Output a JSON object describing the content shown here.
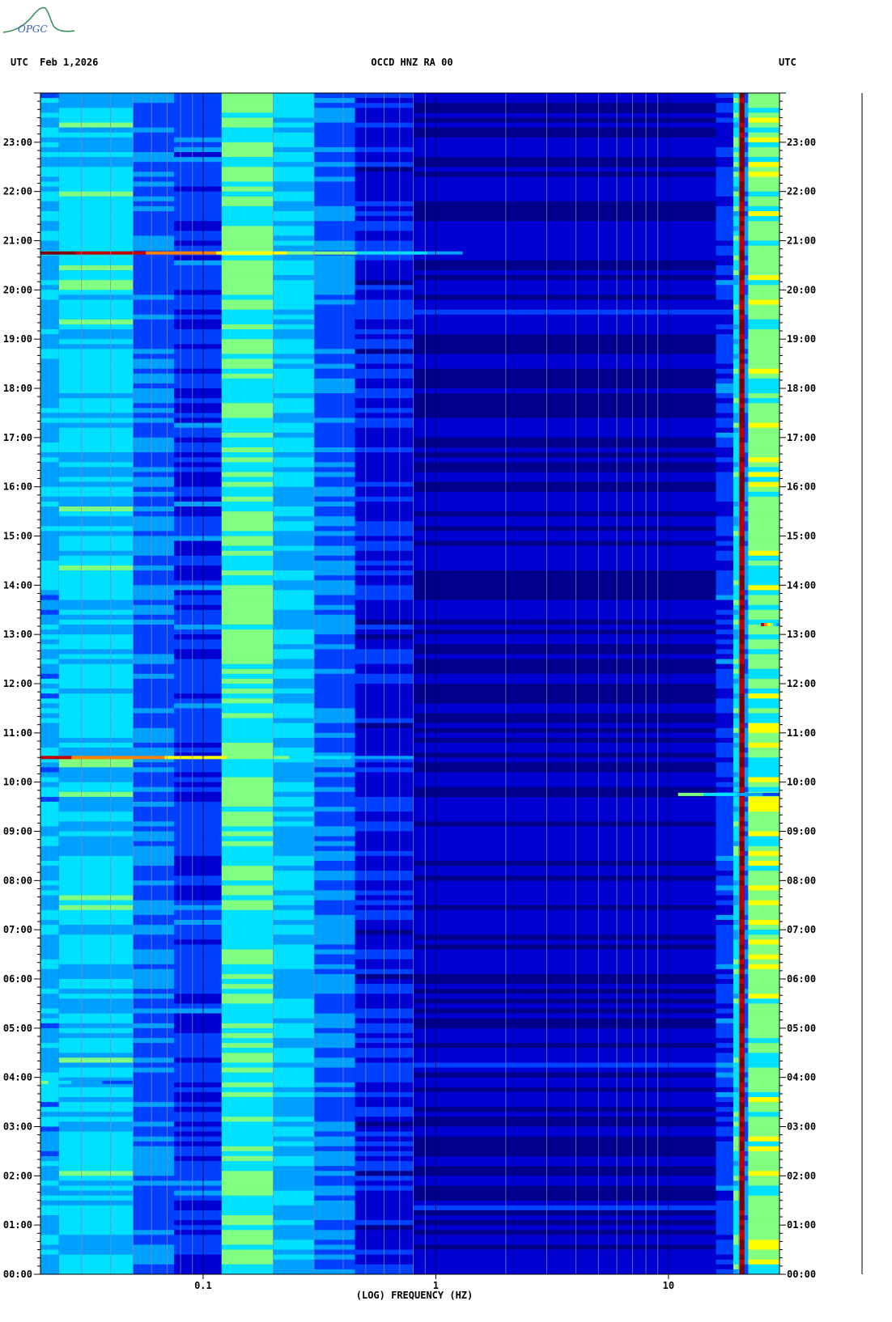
{
  "header": {
    "left": "UTC  Feb 1,2026",
    "center": "OCCD HNZ RA 00",
    "right": "UTC"
  },
  "logo": {
    "text": "OPGC",
    "color": "#2e8b57"
  },
  "chart_data": {
    "type": "heatmap",
    "xlabel": "(LOG) FREQUENCY (HZ)",
    "x_scale": "log",
    "xlim": [
      0.02,
      30
    ],
    "x_ticks": [
      {
        "value": 0.1,
        "label": "0.1"
      },
      {
        "value": 1,
        "label": "1"
      },
      {
        "value": 10,
        "label": "10"
      }
    ],
    "ylim_hours": [
      0,
      24
    ],
    "y_ticks": [
      "00:00",
      "01:00",
      "02:00",
      "03:00",
      "04:00",
      "05:00",
      "06:00",
      "07:00",
      "08:00",
      "09:00",
      "10:00",
      "11:00",
      "12:00",
      "13:00",
      "14:00",
      "15:00",
      "16:00",
      "17:00",
      "18:00",
      "19:00",
      "20:00",
      "21:00",
      "22:00",
      "23:00"
    ],
    "colorscale": [
      "#00008c",
      "#0000d2",
      "#0040ff",
      "#00a0ff",
      "#00e0ff",
      "#80ff80",
      "#ffff00",
      "#ff8000",
      "#c00000",
      "#800000"
    ],
    "bands": [
      {
        "from": 0.02,
        "to": 0.024,
        "level": 0.36
      },
      {
        "from": 0.024,
        "to": 0.05,
        "level": 0.42
      },
      {
        "from": 0.05,
        "to": 0.075,
        "level": 0.26
      },
      {
        "from": 0.075,
        "to": 0.12,
        "level": 0.2
      },
      {
        "from": 0.12,
        "to": 0.2,
        "level": 0.5
      },
      {
        "from": 0.2,
        "to": 0.3,
        "level": 0.4
      },
      {
        "from": 0.3,
        "to": 0.45,
        "level": 0.26
      },
      {
        "from": 0.45,
        "to": 0.8,
        "level": 0.14
      },
      {
        "from": 0.8,
        "to": 16,
        "level": 0.08
      },
      {
        "from": 16,
        "to": 19,
        "level": 0.2
      },
      {
        "from": 19,
        "to": 20.2,
        "level": 0.45
      },
      {
        "from": 20.2,
        "to": 21.2,
        "level": 0.95
      },
      {
        "from": 21.2,
        "to": 22,
        "level": 0.3
      },
      {
        "from": 22,
        "to": 30,
        "level": 0.55
      }
    ],
    "events": [
      {
        "hour": 20.75,
        "from": 0.02,
        "to": 1.3,
        "level": 0.95
      },
      {
        "hour": 10.5,
        "from": 0.02,
        "to": 0.8,
        "level": 0.88
      },
      {
        "hour": 9.75,
        "from": 11,
        "to": 30,
        "level": 0.6
      },
      {
        "hour": 13.2,
        "from": 25,
        "to": 30,
        "level": 0.9
      },
      {
        "hour": 3.9,
        "from": 0.02,
        "to": 0.05,
        "level": 0.5
      }
    ]
  }
}
